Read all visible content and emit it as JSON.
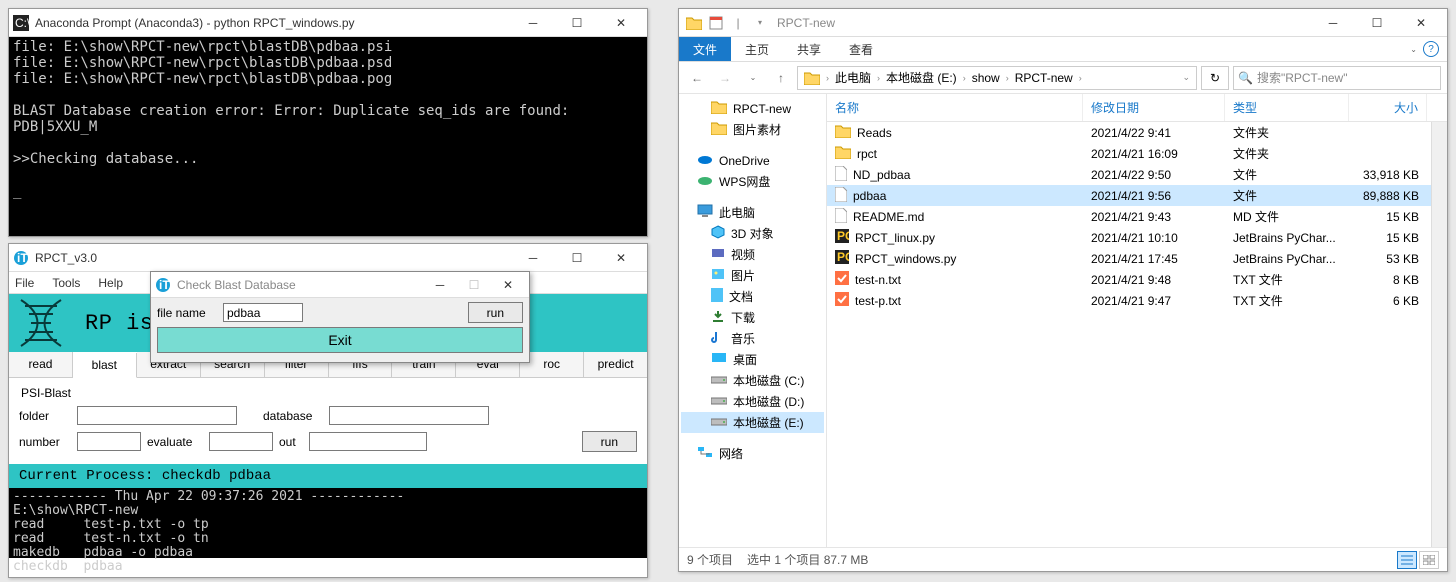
{
  "term": {
    "title": "Anaconda Prompt (Anaconda3) - python  RPCT_windows.py",
    "lines": "file: E:\\show\\RPCT-new\\rpct\\blastDB\\pdbaa.psi\nfile: E:\\show\\RPCT-new\\rpct\\blastDB\\pdbaa.psd\nfile: E:\\show\\RPCT-new\\rpct\\blastDB\\pdbaa.pog\n\nBLAST Database creation error: Error: Duplicate seq_ids are found:\nPDB|5XXU_M\n\n>>Checking database...\n\n_"
  },
  "rpct": {
    "title": "RPCT_v3.0",
    "menu": {
      "file": "File",
      "tools": "Tools",
      "help": "Help"
    },
    "banner": "RP                          is Tool",
    "tabs": [
      "read",
      "blast",
      "extract",
      "search",
      "filter",
      "fffs",
      "train",
      "eval",
      "roc",
      "predict"
    ],
    "active_tab": "blast",
    "form_title": "PSI-Blast",
    "labels": {
      "folder": "folder",
      "database": "database",
      "number": "number",
      "evaluate": "evaluate",
      "out": "out",
      "run": "run"
    },
    "process_label": "Current Process:  checkdb  pdbaa",
    "console": "------------ Thu Apr 22 09:37:26 2021 ------------\nE:\\show\\RPCT-new\nread     test-p.txt -o tp\nread     test-n.txt -o tn\nmakedb   pdbaa -o pdbaa\ncheckdb  pdbaa"
  },
  "cbd": {
    "title": "Check Blast Database",
    "filename_label": "file name",
    "filename_value": "pdbaa",
    "run": "run",
    "exit": "Exit"
  },
  "exp": {
    "title": "RPCT-new",
    "ribbon": {
      "file": "文件",
      "home": "主页",
      "share": "共享",
      "view": "查看"
    },
    "crumbs": [
      "此电脑",
      "本地磁盘 (E:)",
      "show",
      "RPCT-new"
    ],
    "search_placeholder": "搜索\"RPCT-new\"",
    "cols": {
      "name": "名称",
      "date": "修改日期",
      "type": "类型",
      "size": "大小"
    },
    "nav": {
      "quick": [
        {
          "icon": "folder",
          "label": "RPCT-new"
        },
        {
          "icon": "folder",
          "label": "图片素材"
        }
      ],
      "cloud": [
        {
          "icon": "onedrive",
          "label": "OneDrive"
        },
        {
          "icon": "wps",
          "label": "WPS网盘"
        }
      ],
      "pc_label": "此电脑",
      "pc": [
        {
          "icon": "3d",
          "label": "3D 对象"
        },
        {
          "icon": "video",
          "label": "视频"
        },
        {
          "icon": "pic",
          "label": "图片"
        },
        {
          "icon": "doc",
          "label": "文档"
        },
        {
          "icon": "dl",
          "label": "下载"
        },
        {
          "icon": "music",
          "label": "音乐"
        },
        {
          "icon": "desktop",
          "label": "桌面"
        },
        {
          "icon": "drive",
          "label": "本地磁盘 (C:)"
        },
        {
          "icon": "drive",
          "label": "本地磁盘 (D:)"
        },
        {
          "icon": "drive",
          "label": "本地磁盘 (E:)",
          "sel": true
        }
      ],
      "net_label": "网络"
    },
    "files": [
      {
        "icon": "folder",
        "name": "Reads",
        "date": "2021/4/22 9:41",
        "type": "文件夹",
        "size": ""
      },
      {
        "icon": "folder",
        "name": "rpct",
        "date": "2021/4/21 16:09",
        "type": "文件夹",
        "size": ""
      },
      {
        "icon": "file",
        "name": "ND_pdbaa",
        "date": "2021/4/22 9:50",
        "type": "文件",
        "size": "33,918 KB"
      },
      {
        "icon": "file",
        "name": "pdbaa",
        "date": "2021/4/21 9:56",
        "type": "文件",
        "size": "89,888 KB",
        "sel": true
      },
      {
        "icon": "md",
        "name": "README.md",
        "date": "2021/4/21 9:43",
        "type": "MD 文件",
        "size": "15 KB"
      },
      {
        "icon": "py",
        "name": "RPCT_linux.py",
        "date": "2021/4/21 10:10",
        "type": "JetBrains PyChar...",
        "size": "15 KB"
      },
      {
        "icon": "py",
        "name": "RPCT_windows.py",
        "date": "2021/4/21 17:45",
        "type": "JetBrains PyChar...",
        "size": "53 KB"
      },
      {
        "icon": "txt",
        "name": "test-n.txt",
        "date": "2021/4/21 9:48",
        "type": "TXT 文件",
        "size": "8 KB"
      },
      {
        "icon": "txt",
        "name": "test-p.txt",
        "date": "2021/4/21 9:47",
        "type": "TXT 文件",
        "size": "6 KB"
      }
    ],
    "status": {
      "count": "9 个项目",
      "sel": "选中 1 个项目  87.7 MB"
    }
  }
}
